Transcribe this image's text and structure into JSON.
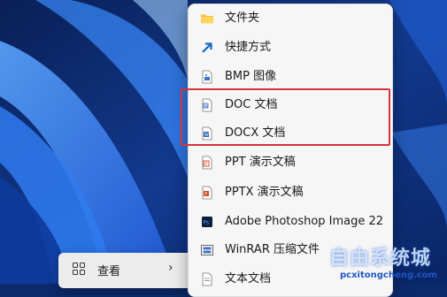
{
  "context_menu": {
    "items": [
      {
        "label": "文件夹",
        "icon": "folder-icon"
      },
      {
        "label": "快捷方式",
        "icon": "shortcut-icon"
      },
      {
        "label": "BMP 图像",
        "icon": "bmp-image-icon"
      },
      {
        "label": "DOC 文档",
        "icon": "word-doc-icon"
      },
      {
        "label": "DOCX 文档",
        "icon": "word-docx-icon"
      },
      {
        "label": "PPT 演示文稿",
        "icon": "ppt-icon"
      },
      {
        "label": "PPTX 演示文稿",
        "icon": "pptx-icon"
      },
      {
        "label": "Adobe Photoshop Image 22",
        "icon": "photoshop-icon"
      },
      {
        "label": "WinRAR 压缩文件",
        "icon": "winrar-icon"
      },
      {
        "label": "文本文档",
        "icon": "text-document-icon"
      }
    ]
  },
  "parent_menu": {
    "label": "查看",
    "icon": "view-grid-icon"
  },
  "watermark": {
    "text": "自由系统城",
    "url": "pcxitongcheng.com"
  },
  "colors": {
    "highlight_border": "#d6343a",
    "menu_bg": "#f6f6f6"
  }
}
